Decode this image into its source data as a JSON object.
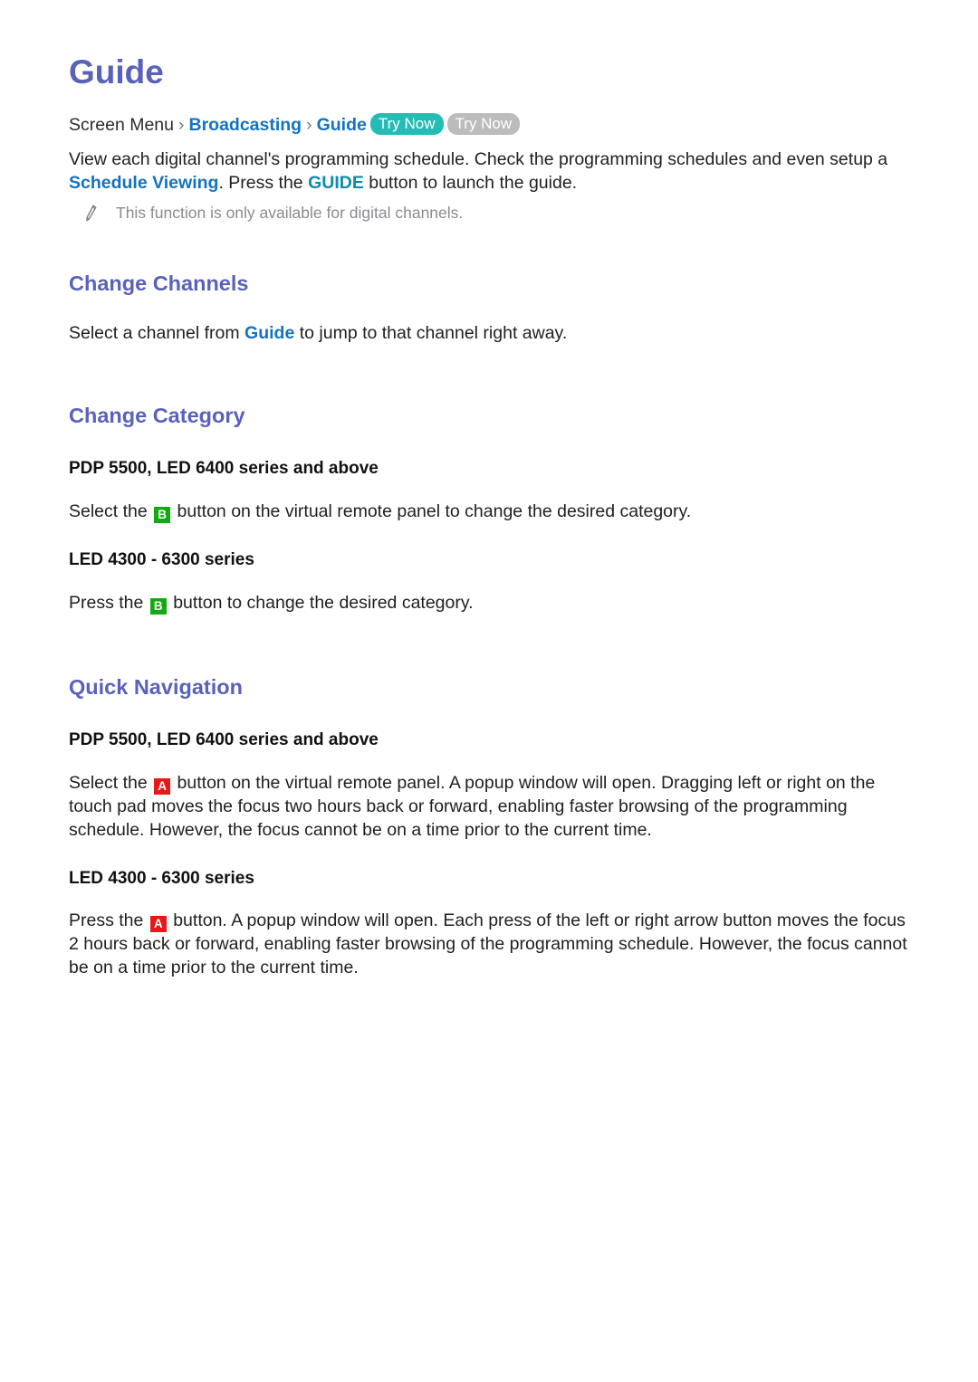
{
  "document": {
    "title": "Guide",
    "breadcrumb": {
      "root_label": "Screen Menu",
      "separator": "›",
      "link1_label": "Broadcasting",
      "link2_label": "Guide",
      "badge_try_now_1": "Try Now",
      "badge_try_now_2": "Try Now",
      "badge_color_1": "#23bdb6",
      "badge_color_2": "#bcbcbc"
    },
    "intro": {
      "text_part_1": "View each digital channel's programming schedule. Check the programming schedules and even setup a ",
      "link_schedule_viewing": "Schedule Viewing",
      "text_part_2": ". Press the ",
      "link_guide_button": "GUIDE",
      "text_part_3": " button to launch the guide."
    },
    "note": {
      "icon": "pencil-icon",
      "text": "This function is only available for digital channels."
    },
    "sections": [
      {
        "heading": "Change Channels",
        "paragraphs": [
          {
            "text_part_1": "Select a channel from ",
            "link": "Guide",
            "text_part_2": " to jump to that channel right away."
          }
        ]
      },
      {
        "heading": "Change Category",
        "blocks": [
          {
            "subhead": "PDP 5500, LED 6400 series and above",
            "text_part_1": "Select the ",
            "key_label": "B",
            "key_color": "#11aa11",
            "text_part_2": " button on the virtual remote panel to change the desired category."
          },
          {
            "subhead": "LED 4300 - 6300 series",
            "text_part_1": "Press the ",
            "key_label": "B",
            "key_color": "#11aa11",
            "text_part_2": " button to change the desired category."
          }
        ]
      },
      {
        "heading": "Quick Navigation",
        "blocks": [
          {
            "subhead": "PDP 5500, LED 6400 series and above",
            "text_part_1": "Select the ",
            "key_label": "A",
            "key_color": "#e81818",
            "text_part_2": " button on the virtual remote panel. A popup window will open. Dragging left or right on the touch pad moves the focus two hours back or forward, enabling faster browsing of the programming schedule. However, the focus cannot be on a time prior to the current time."
          },
          {
            "subhead": "LED 4300 - 6300 series",
            "text_part_1": "Press the ",
            "key_label": "A",
            "key_color": "#e81818",
            "text_part_2": " button. A popup window will open. Each press of the left or right arrow button moves the focus 2 hours back or forward, enabling faster browsing of the programming schedule. However, the focus cannot be on a time prior to the current time."
          }
        ]
      }
    ],
    "colors": {
      "heading": "#5a62b8",
      "link_blue": "#1373be",
      "link_teal": "#0e8bac",
      "body_text": "#1f1f1f",
      "note_text": "#8b8b93"
    }
  }
}
